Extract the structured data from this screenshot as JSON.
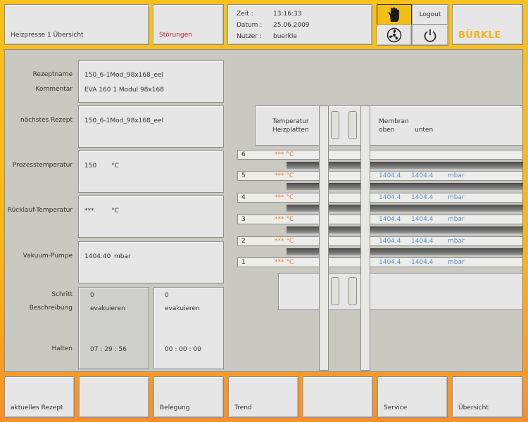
{
  "header": {
    "title": "Heizpresse 1 Übersicht",
    "faults": "Störungen",
    "info": {
      "time_label": "Zeit :",
      "time_value": "13:16:33",
      "date_label": "Datum :",
      "date_value": "25.06.2009",
      "user_label": "Nutzer :",
      "user_value": "buerkle"
    },
    "logout": "Logout",
    "logo": "BÜRKLE"
  },
  "recipe": {
    "name_label": "Rezeptname",
    "name_value": "150_6-1Mod_98x168_eel",
    "comment_label": "Kommentar",
    "comment_value": "EVA 160  1 Modul 98x168",
    "next_label": "nächstes Rezept",
    "next_value": "150_6-1Mod_98x168_eel"
  },
  "process": {
    "process_temp_label": "Prozesstemperatur",
    "process_temp_value": "150",
    "process_temp_unit": "°C",
    "return_temp_label": "Rücklauf-Temperatur",
    "return_temp_value": "***",
    "return_temp_unit": "°C",
    "vacuum_label": "Vakuum-Pumpe",
    "vacuum_value": "1404.40",
    "vacuum_unit": "mbar"
  },
  "step": {
    "step_label": "Schritt",
    "desc_label": "Beschreibung",
    "hold_label": "Halten",
    "current": {
      "step": "0",
      "desc": "evakuieren",
      "hold": "07 : 29 : 56"
    },
    "next": {
      "step": "0",
      "desc": "evakuieren",
      "hold": "00 : 00 : 00"
    }
  },
  "diagram": {
    "temp_header_1": "Temperatur",
    "temp_header_2": "Heizplatten",
    "mem_header_1": "Membran",
    "mem_header_2": "oben",
    "mem_header_3": "unten",
    "rows": [
      {
        "num": "6",
        "temp": "*** °C",
        "top": "",
        "bottom": "",
        "unit": ""
      },
      {
        "num": "5",
        "temp": "*** °C",
        "top": "1404.4",
        "bottom": "1404.4",
        "unit": "mbar"
      },
      {
        "num": "4",
        "temp": "*** °C",
        "top": "1404.4",
        "bottom": "1404.4",
        "unit": "mbar"
      },
      {
        "num": "3",
        "temp": "*** °C",
        "top": "1404.4",
        "bottom": "1404.4",
        "unit": "mbar"
      },
      {
        "num": "2",
        "temp": "*** °C",
        "top": "1404.4",
        "bottom": "1404.4",
        "unit": "mbar"
      },
      {
        "num": "1",
        "temp": "*** °C",
        "top": "1404.4",
        "bottom": "1404.4",
        "unit": "mbar"
      }
    ]
  },
  "footer": {
    "buttons": [
      "aktuelles Rezept",
      "",
      "Belegung",
      "Trend",
      "",
      "Service",
      "Übersicht"
    ]
  },
  "colors": {
    "accent": "#f9c11b",
    "fault_text": "#c0203a",
    "temp_text": "#e27a2b",
    "mbar_text": "#5a8ed1",
    "panel": "#c9c8c1"
  }
}
